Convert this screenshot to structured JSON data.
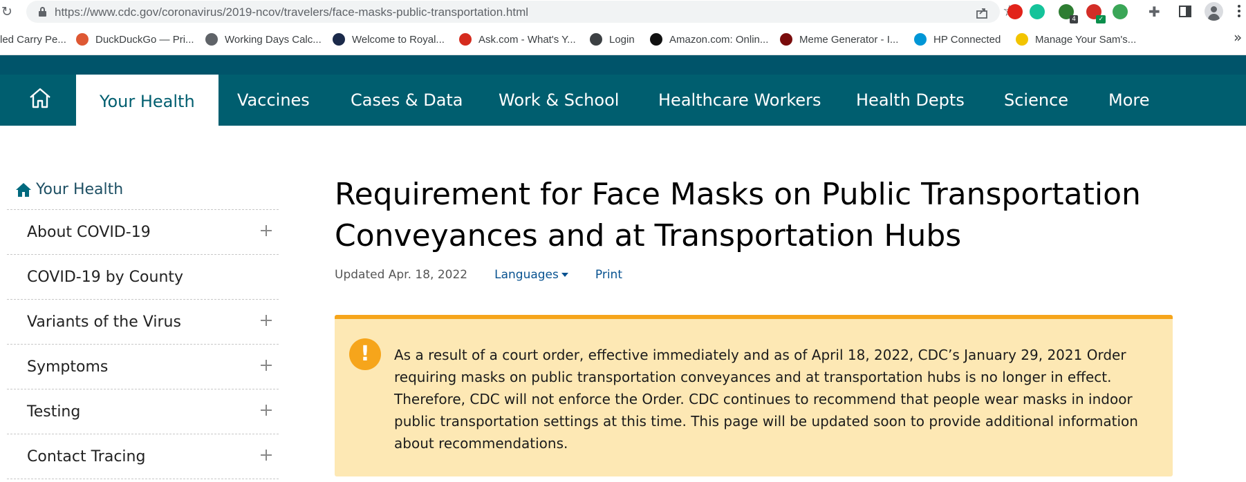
{
  "browser": {
    "url": "https://www.cdc.gov/coronavirus/2019-ncov/travelers/face-masks-public-transportation.html",
    "extensions": [
      {
        "name": "adblock-icon",
        "color": "#e2231a",
        "badge": ""
      },
      {
        "name": "grammarly-icon",
        "color": "#15c39a",
        "badge": ""
      },
      {
        "name": "shield-extension-icon",
        "color": "#2e7d32",
        "badge": "4"
      },
      {
        "name": "lastpass-icon",
        "color": "#d32d27",
        "badge": "✓"
      },
      {
        "name": "b-plus-icon",
        "color": "#3aa657",
        "badge": ""
      }
    ]
  },
  "bookmarks": [
    {
      "label": "led Carry Pe...",
      "icon": "none",
      "color": "#ffffff"
    },
    {
      "label": "DuckDuckGo — Pri...",
      "icon": "duckduckgo-icon",
      "color": "#de5833"
    },
    {
      "label": "Working Days Calc...",
      "icon": "globe-icon",
      "color": "#5f6368"
    },
    {
      "label": "Welcome to Royal...",
      "icon": "royal-caribbean-icon",
      "color": "#1b2a4a"
    },
    {
      "label": "Ask.com - What's Y...",
      "icon": "ask-icon",
      "color": "#d52b1e"
    },
    {
      "label": "Login",
      "icon": "login-c-icon",
      "color": "#3c4043"
    },
    {
      "label": "Amazon.com: Onlin...",
      "icon": "amazon-icon",
      "color": "#111111"
    },
    {
      "label": "Meme Generator - I...",
      "icon": "meme-generator-icon",
      "color": "#7a0c0c"
    },
    {
      "label": "HP Connected",
      "icon": "hp-icon",
      "color": "#0096d6"
    },
    {
      "label": "Manage Your Sam's...",
      "icon": "sams-club-icon",
      "color": "#f2c400"
    }
  ],
  "sitenav": {
    "items": [
      "Your Health",
      "Vaccines",
      "Cases & Data",
      "Work & School",
      "Healthcare Workers",
      "Health Depts",
      "Science",
      "More"
    ]
  },
  "sidebar": {
    "header": "Your Health",
    "items": [
      {
        "label": "About COVID-19",
        "expandable": true
      },
      {
        "label": "COVID-19 by County",
        "expandable": false
      },
      {
        "label": "Variants of the Virus",
        "expandable": true
      },
      {
        "label": "Symptoms",
        "expandable": true
      },
      {
        "label": "Testing",
        "expandable": true
      },
      {
        "label": "Contact Tracing",
        "expandable": true
      }
    ]
  },
  "main": {
    "title": "Requirement for Face Masks on Public Transportation Conveyances and at Transportation Hubs",
    "updated": "Updated Apr. 18, 2022",
    "languages": "Languages",
    "print": "Print",
    "alert_icon": "!",
    "alert_text": "As a result of a court order, effective immediately and as of April 18, 2022, CDC’s January 29, 2021 Order requiring masks on public transportation conveyances and at transportation hubs is no longer in effect. Therefore, CDC will not enforce the Order. CDC continues to recommend that people wear masks in indoor public transportation settings at this time. This page will be updated soon to provide additional information about recommendations."
  },
  "colors": {
    "nav_bg": "#005e6f",
    "alert_bg": "#fde8b4",
    "alert_accent": "#f6a51b",
    "link": "#075290"
  }
}
